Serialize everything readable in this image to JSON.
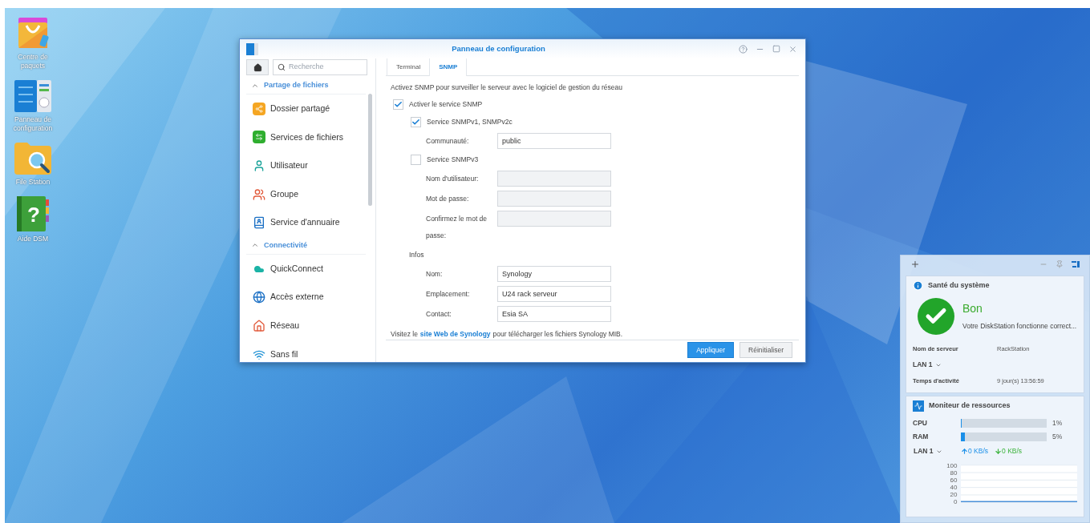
{
  "desktop_icons": [
    {
      "kind": "package",
      "label": "Centre de paquets"
    },
    {
      "kind": "control",
      "label": "Panneau de configuration"
    },
    {
      "kind": "folder",
      "label": "File Station"
    },
    {
      "kind": "help",
      "label": "Aide DSM",
      "glyph": "?"
    }
  ],
  "window": {
    "title": "Panneau de configuration",
    "search": {
      "placeholder": "Recherche"
    },
    "sidebar": [
      {
        "title": "Partage de fichiers",
        "expanded": true,
        "items": [
          {
            "kind": "shared",
            "label": "Dossier partagé"
          },
          {
            "kind": "files",
            "label": "Services de fichiers"
          },
          {
            "kind": "user",
            "label": "Utilisateur"
          },
          {
            "kind": "group",
            "label": "Groupe"
          },
          {
            "kind": "directory",
            "label": "Service d'annuaire"
          }
        ]
      },
      {
        "title": "Connectivité",
        "expanded": true,
        "items": [
          {
            "kind": "cloud",
            "label": "QuickConnect"
          },
          {
            "kind": "globe",
            "label": "Accès externe"
          },
          {
            "kind": "home",
            "label": "Réseau"
          },
          {
            "kind": "wifi",
            "label": "Sans fil"
          }
        ]
      }
    ],
    "tabs": [
      {
        "label": "Terminal",
        "selected": false
      },
      {
        "label": "SNMP",
        "selected": true
      }
    ],
    "intro": "Activez SNMP pour surveiller le serveur avec le logiciel de gestion du réseau",
    "rows": [
      {
        "kind": "main_checkbox",
        "label": "Activer le service SNMP",
        "checked": true
      },
      {
        "kind": "checkbox",
        "label": "Service SNMPv1, SNMPv2c",
        "checked": true
      },
      {
        "kind": "field",
        "label": "Communauté:",
        "value": "public",
        "disabled": false
      },
      {
        "kind": "checkbox",
        "label": "Service SNMPv3",
        "checked": false
      },
      {
        "kind": "field",
        "label": "Nom d'utilisateur:",
        "value": "",
        "disabled": true
      },
      {
        "kind": "field",
        "label": "Mot de passe:",
        "value": "",
        "disabled": true
      },
      {
        "kind": "field",
        "label": "Confirmez le mot de passe:",
        "value": "",
        "disabled": true
      },
      {
        "kind": "heading",
        "label": "Infos"
      },
      {
        "kind": "field",
        "label": "Nom:",
        "value": "Synology",
        "disabled": false
      },
      {
        "kind": "field",
        "label": "Emplacement:",
        "value": "U24 rack serveur",
        "disabled": false
      },
      {
        "kind": "field",
        "label": "Contact:",
        "value": "Esia SA",
        "disabled": false
      }
    ],
    "footer": {
      "before": "Visitez le",
      "link": "site Web de Synology",
      "after": "pour télécharger les fichiers Synology MIB."
    },
    "buttons": [
      {
        "kind": "primary",
        "label": "Appliquer"
      },
      {
        "kind": "secondary",
        "label": "Réinitialiser"
      }
    ]
  },
  "widgets": {
    "health": {
      "title": "Santé du système",
      "status": "Bon",
      "message": "Votre DiskStation fonctionne correct...",
      "rows": [
        {
          "kind": "pair",
          "label": "Nom de serveur",
          "value": "RackStation"
        },
        {
          "kind": "dropdown",
          "label": "LAN 1"
        },
        {
          "kind": "pair",
          "label": "Temps d'activité",
          "value": "9 jour(s) 13:56:59"
        }
      ]
    },
    "resources": {
      "title": "Moniteur de ressources",
      "meters": [
        {
          "label": "CPU",
          "level": 0.01,
          "reading": "1%"
        },
        {
          "label": "RAM",
          "level": 0.05,
          "reading": "5%"
        }
      ],
      "network": {
        "label": "LAN 1",
        "upload": "0 KB/s",
        "download": "0 KB/s"
      },
      "chart_data": {
        "type": "line",
        "grid": true,
        "ylim": [
          0,
          100
        ],
        "yticks": [
          0,
          20,
          40,
          60,
          80,
          100
        ],
        "series": [
          {
            "color": "#4a90d9",
            "values": [
              0,
              0,
              0,
              0,
              0,
              0,
              0,
              0,
              0,
              0
            ]
          }
        ]
      }
    }
  }
}
